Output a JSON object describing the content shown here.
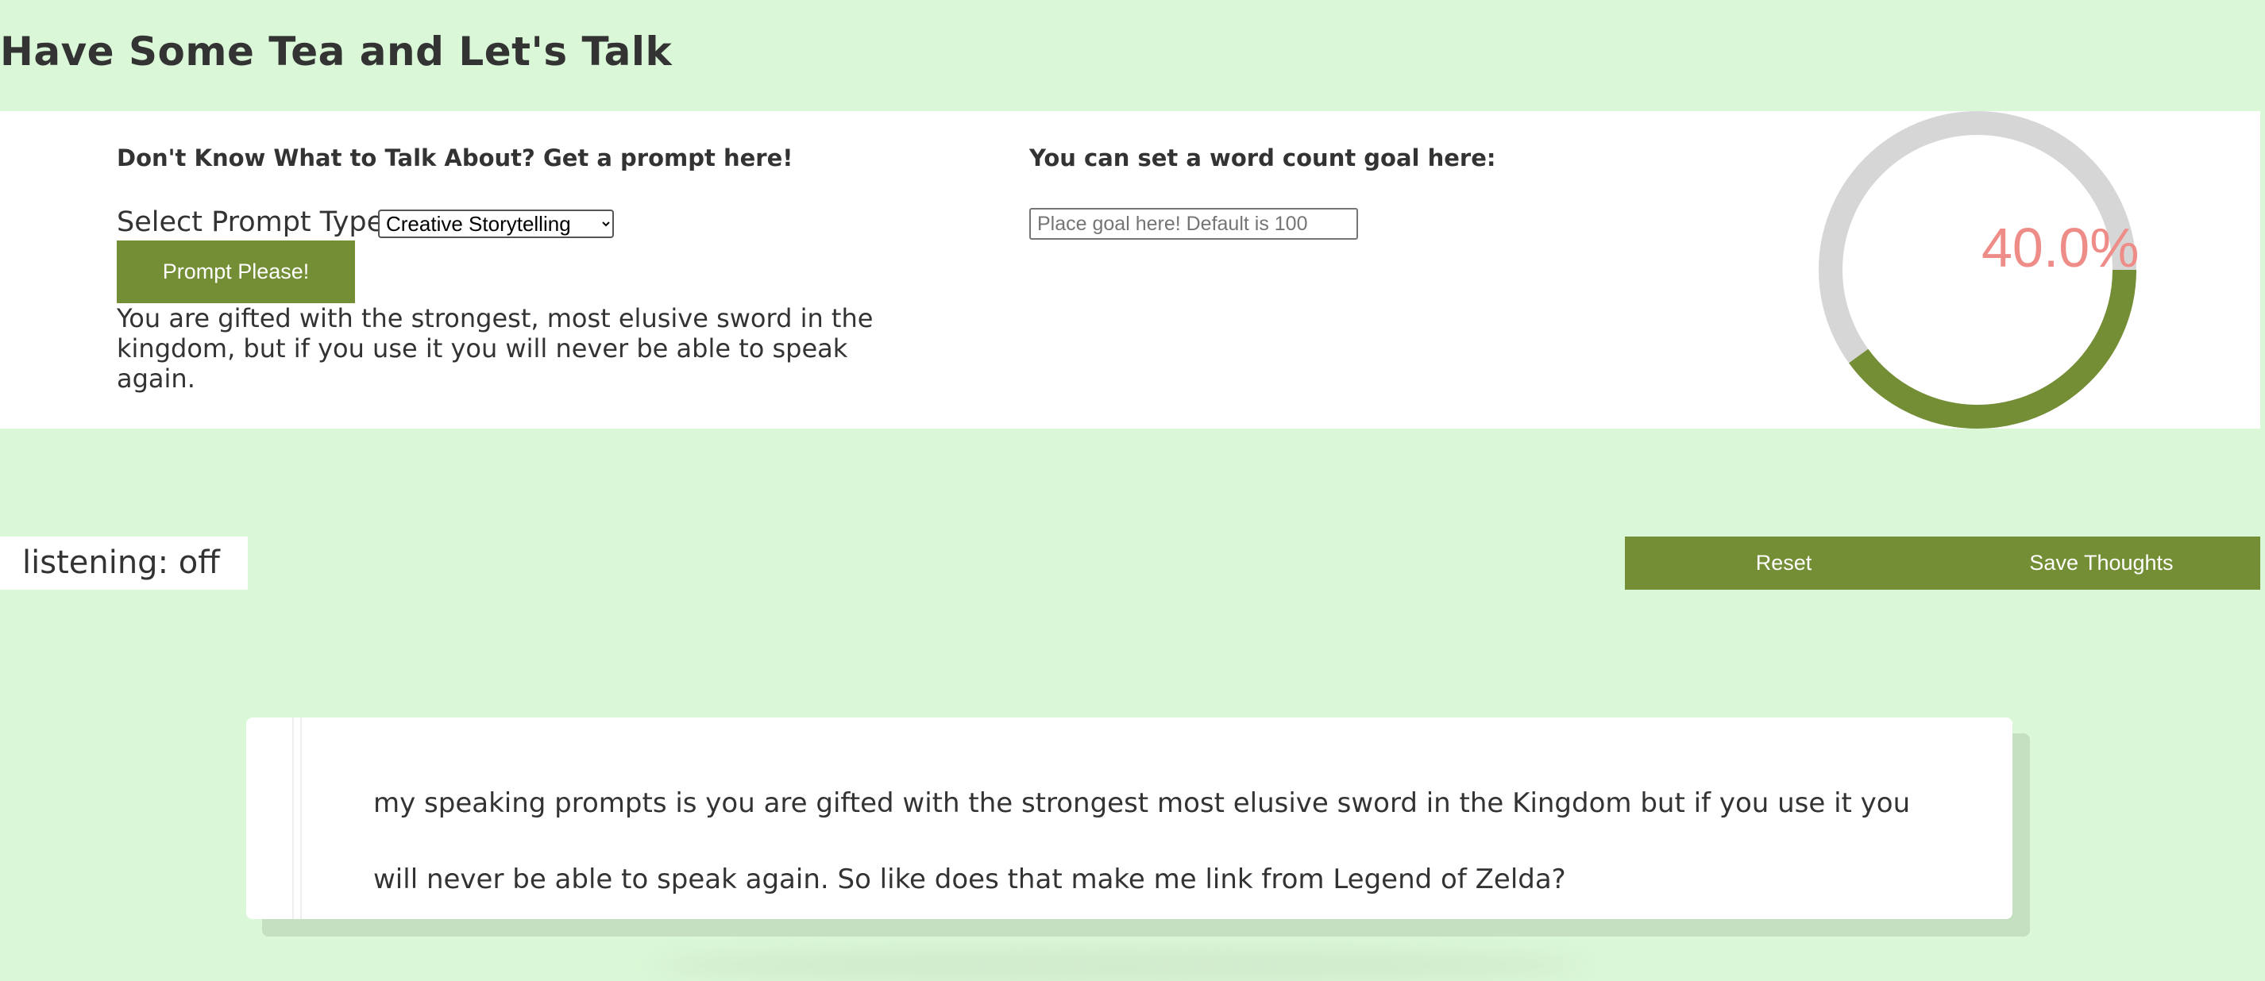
{
  "header": {
    "title": "Have Some Tea and Let's Talk"
  },
  "prompt_section": {
    "heading": "Don't Know What to Talk About? Get a prompt here!",
    "select_label": "Select Prompt Type:",
    "select_value": "Creative Storytelling",
    "select_options": [
      "Creative Storytelling"
    ],
    "button_label": "Prompt Please!",
    "prompt_text": "You are gifted with the strongest, most elusive sword in the kingdom, but if you use it you will never be able to speak again."
  },
  "goal_section": {
    "heading": "You can set a word count goal here:",
    "input_placeholder": "Place goal here! Default is 100",
    "input_value": ""
  },
  "progress": {
    "value": 0.4,
    "label": "40.0%",
    "track_color": "#d6d6d6",
    "fill_color": "#738e34",
    "text_color": "#ee8c88"
  },
  "status": {
    "listening": "listening: off"
  },
  "actions": {
    "reset_label": "Reset",
    "save_label": "Save Thoughts"
  },
  "transcript": {
    "text": "my speaking prompts is you are gifted with the strongest most elusive sword in the Kingdom but if you use it you will never be able to speak again. So like does that make me link from Legend of Zelda?"
  },
  "colors": {
    "background": "#daf8d7",
    "accent": "#738e34",
    "panel": "#ffffff",
    "text": "#333333"
  }
}
